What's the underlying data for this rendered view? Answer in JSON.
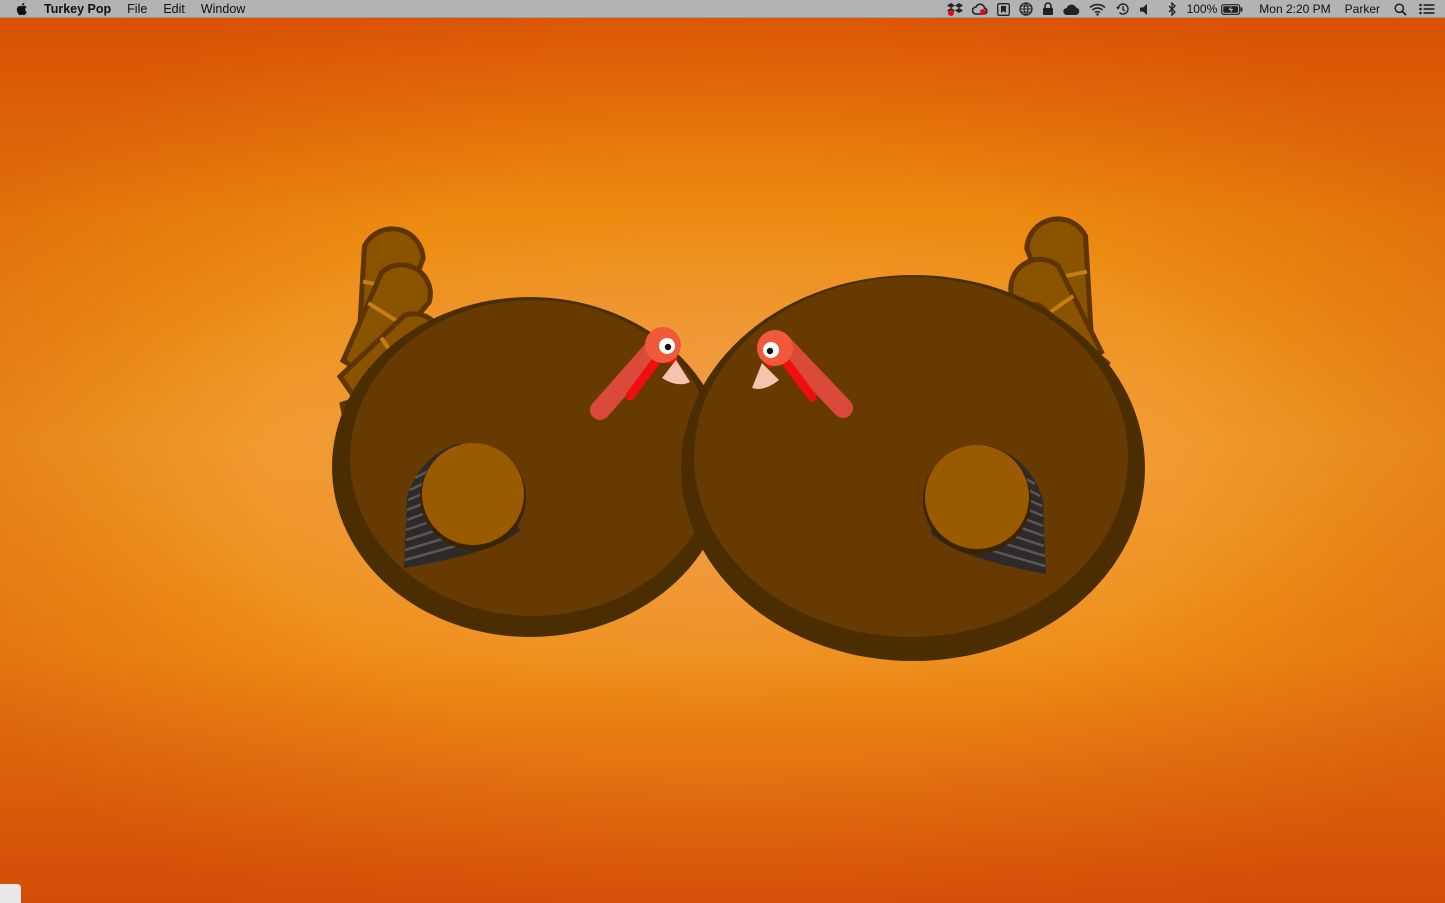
{
  "menubar": {
    "app_name": "Turkey Pop",
    "menus": [
      "File",
      "Edit",
      "Window"
    ],
    "status_icons": [
      "dropbox-icon",
      "creative-cloud-icon",
      "box-app-icon",
      "globe-icon",
      "lock-icon",
      "cloud-icon",
      "wifi-icon",
      "time-machine-icon",
      "volume-icon",
      "bluetooth-icon"
    ],
    "battery_percent": "100%",
    "clock": "Mon 2:20 PM",
    "user": "Parker"
  },
  "desktop": {
    "background_colors": [
      "#e05e06",
      "#f09b25",
      "#f5a04a"
    ]
  },
  "turkeys": [
    {
      "name": "left-turkey",
      "body_color": "#663a00",
      "tail_color": "#8a5300",
      "wattle_color": "#f0463a"
    },
    {
      "name": "right-turkey",
      "body_color": "#663a00",
      "tail_color": "#8a5300",
      "wattle_color": "#f0463a"
    }
  ]
}
